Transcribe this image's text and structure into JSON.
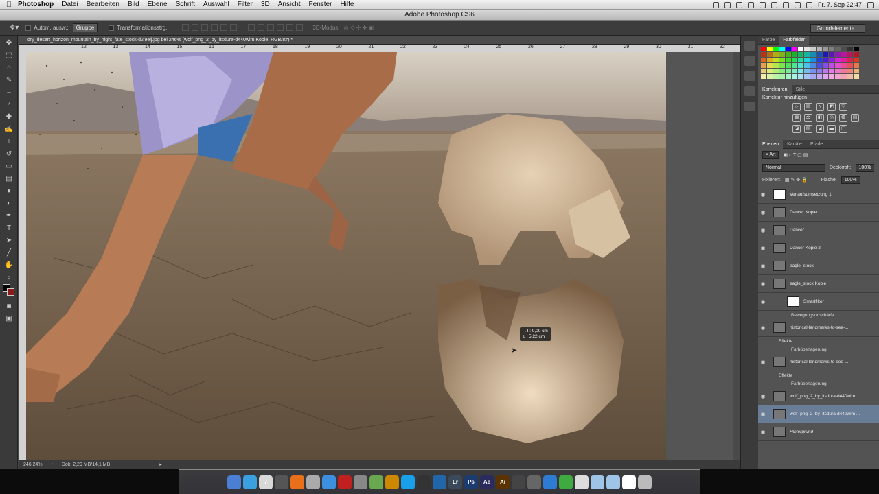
{
  "menubar": {
    "app": "Photoshop",
    "items": [
      "Datei",
      "Bearbeiten",
      "Bild",
      "Ebene",
      "Schrift",
      "Auswahl",
      "Filter",
      "3D",
      "Ansicht",
      "Fenster",
      "Hilfe"
    ],
    "clock": "Fr. 7. Sep  22:47"
  },
  "window": {
    "title": "Adobe Photoshop CS6"
  },
  "options": {
    "autoselect_label": "Autom. ausw.:",
    "autoselect_value": "Gruppe",
    "transform_label": "Transformationsstrg.",
    "mode3d_label": "3D-Modus:",
    "workspace": "Grundelemente"
  },
  "document": {
    "tab": "dry_desert_horizon_mountain_by_night_fate_stock-d2i9eij.jpg bei 246% (wolf_png_2_by_itsdura-d440wim Kopie, RGB/8#) *",
    "ruler_ticks": [
      "12",
      "13",
      "14",
      "15",
      "16",
      "17",
      "18",
      "19",
      "20",
      "21",
      "22",
      "23",
      "24",
      "25",
      "26",
      "27",
      "28",
      "29",
      "30",
      "31",
      "32",
      "33"
    ],
    "zoom": "246,24%",
    "doc_size": "Dok: 2,29 MB/14,1 MB",
    "tooltip_line1": "→I : 0,00 cm",
    "tooltip_line2": "± : 5,22 cm"
  },
  "panels": {
    "color_tabs": [
      "Farbe",
      "Farbfelder"
    ],
    "adj_tabs": [
      "Korrekturen",
      "Stile"
    ],
    "adj_title": "Korrektur hinzufügen",
    "layer_tabs": [
      "Ebenen",
      "Kanäle",
      "Pfade"
    ],
    "filter_kind": "Art",
    "blend_mode": "Normal",
    "opacity_label": "Deckkraft:",
    "opacity_value": "100%",
    "lock_label": "Fixieren:",
    "fill_label": "Fläche:",
    "fill_value": "100%",
    "swatch_colors": [
      "#ff0000",
      "#ffff00",
      "#00ff00",
      "#00ffff",
      "#0000ff",
      "#ff00ff",
      "#ffffff",
      "#e6e6e6",
      "#cccccc",
      "#b3b3b3",
      "#999999",
      "#808080",
      "#666666",
      "#4d4d4d",
      "#333333",
      "#000000"
    ]
  },
  "layers": [
    {
      "name": "Verlaufsumsetzung 1",
      "kind": "adjustment"
    },
    {
      "name": "Dancer Kopie",
      "kind": "image"
    },
    {
      "name": "Dancer",
      "kind": "image"
    },
    {
      "name": "Dancer Kopie 2",
      "kind": "image"
    },
    {
      "name": "eagle_stock",
      "kind": "image"
    },
    {
      "name": "eagle_stock Kopie",
      "kind": "smart"
    },
    {
      "name": "Smartfilter",
      "kind": "filter"
    },
    {
      "name": "Bewegungsunschärfe",
      "kind": "filter-item"
    },
    {
      "name": "historical-landmarks-to-see-...",
      "kind": "image"
    },
    {
      "name": "Effekte",
      "kind": "fx"
    },
    {
      "name": "Farbüberlagerung",
      "kind": "fx-item"
    },
    {
      "name": "historical-landmarks-to-see-...",
      "kind": "image"
    },
    {
      "name": "Effekte",
      "kind": "fx"
    },
    {
      "name": "Farbüberlagerung",
      "kind": "fx-item"
    },
    {
      "name": "wolf_png_2_by_itsdura-d440wim",
      "kind": "image"
    },
    {
      "name": "wolf_png_2_by_itsdura-d440wim ...",
      "kind": "selected"
    },
    {
      "name": "Hintergrund",
      "kind": "background"
    }
  ],
  "dock": [
    {
      "label": "",
      "color": "#4a7fd4"
    },
    {
      "label": "",
      "color": "#3aa0e0"
    },
    {
      "label": "7",
      "color": "#d8d8d8"
    },
    {
      "label": "",
      "color": "#555555"
    },
    {
      "label": "",
      "color": "#e8701a"
    },
    {
      "label": "",
      "color": "#aaaaaa"
    },
    {
      "label": "",
      "color": "#3d8fe0"
    },
    {
      "label": "",
      "color": "#c02020"
    },
    {
      "label": "",
      "color": "#888888"
    },
    {
      "label": "",
      "color": "#6aa84f"
    },
    {
      "label": "",
      "color": "#cc8800"
    },
    {
      "label": "",
      "color": "#1aa0e8"
    },
    {
      "label": "",
      "color": "#333333"
    },
    {
      "label": "",
      "color": "#2266aa"
    },
    {
      "label": "Lr",
      "color": "#3a4a5a"
    },
    {
      "label": "Ps",
      "color": "#1c3b6e"
    },
    {
      "label": "Ae",
      "color": "#2a2a5e"
    },
    {
      "label": "Ai",
      "color": "#5a3300"
    },
    {
      "label": "",
      "color": "#444444"
    },
    {
      "label": "",
      "color": "#666666"
    },
    {
      "label": "",
      "color": "#2e7bd4"
    },
    {
      "label": "",
      "color": "#3faa3f"
    },
    {
      "label": "",
      "color": "#dddddd"
    },
    {
      "label": "",
      "color": "#9ec5e8"
    },
    {
      "label": "",
      "color": "#9ec5e8"
    },
    {
      "label": "",
      "color": "#ffffff"
    },
    {
      "label": "",
      "color": "#bbbbbb"
    }
  ]
}
